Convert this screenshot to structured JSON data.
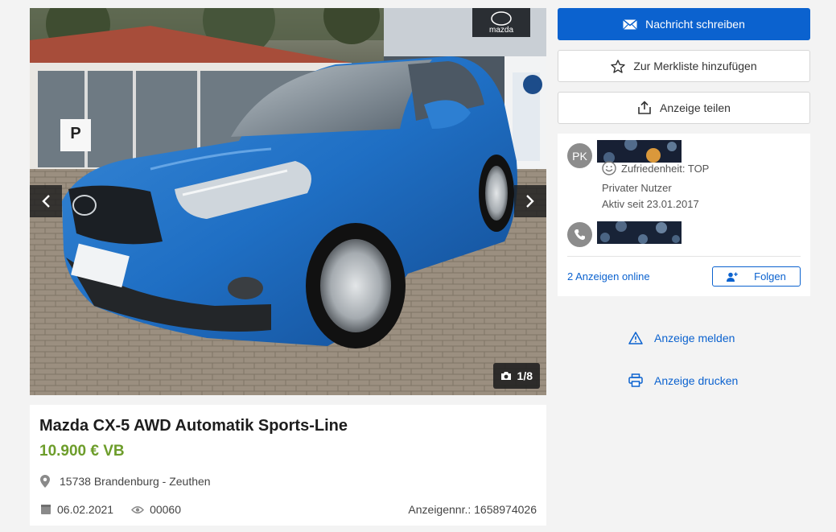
{
  "gallery": {
    "counter": "1/8",
    "dealer_sign": "mazda",
    "parking_sign": "P"
  },
  "ad": {
    "title": "Mazda CX-5 AWD Automatik Sports-Line",
    "price": "10.900 € VB",
    "location": "15738 Brandenburg - Zeuthen",
    "date": "06.02.2021",
    "views": "00060",
    "ad_number": "Anzeigennr.: 1658974026"
  },
  "actions": {
    "message_label": "Nachricht schreiben",
    "watchlist_label": "Zur Merkliste hinzufügen",
    "share_label": "Anzeige teilen",
    "report_label": "Anzeige melden",
    "print_label": "Anzeige drucken"
  },
  "seller": {
    "initials": "PK",
    "satisfaction": "Zufriedenheit: TOP",
    "type": "Privater Nutzer",
    "active_since": "Aktiv seit 23.01.2017",
    "ads_online": "2 Anzeigen online",
    "follow_label": "Folgen"
  },
  "colors": {
    "primary": "#0b62cf",
    "price": "#6d9d2b",
    "car": "#1f6fc4"
  },
  "icons": {
    "message": "envelope-icon",
    "watchlist": "star-icon",
    "share": "share-icon",
    "report": "warning-icon",
    "print": "printer-icon",
    "location": "map-pin-icon",
    "date": "calendar-icon",
    "views": "eye-icon",
    "phone": "phone-icon",
    "camera": "camera-icon",
    "rating": "smiley-icon",
    "follow": "add-user-icon"
  }
}
